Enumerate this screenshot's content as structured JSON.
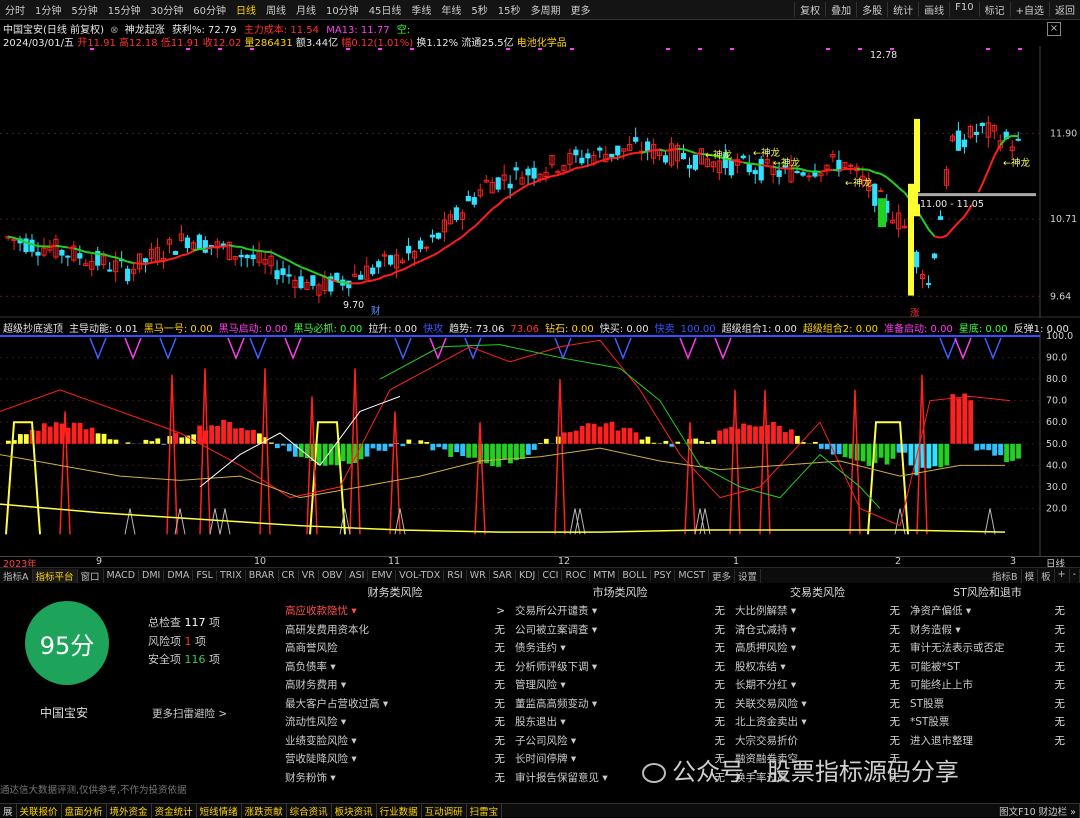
{
  "toolbar": {
    "left": [
      "分时",
      "1分钟",
      "5分钟",
      "15分钟",
      "30分钟",
      "60分钟",
      "日线",
      "周线",
      "月线",
      "10分钟",
      "45日线",
      "季线",
      "年线",
      "5秒",
      "15秒",
      "多周期",
      "更多"
    ],
    "active": "日线",
    "right": [
      "复权",
      "叠加",
      "多股",
      "统计",
      "画线",
      "F10",
      "标记",
      "+自选",
      "返回"
    ]
  },
  "header": {
    "stock": "中国宝安(日线 前复权)",
    "ind_name": "神龙起涨",
    "profit": "获利%: 72.79",
    "main_cost": "主力成本: 11.54",
    "ma13": "MA13: 11.77",
    "empty": "空:"
  },
  "bar": {
    "date": "2024/03/01/五",
    "open": "开11.91",
    "high": "高12.18",
    "low": "低11.91",
    "close": "收12.02",
    "vol": "量286431",
    "amt": "额3.44亿",
    "chg": "幅0.12(1.01%)",
    "turn": "换1.12%",
    "float": "流通25.5亿",
    "sector": "电池化学品"
  },
  "price_axis": [
    "11.90",
    "10.71",
    "9.64"
  ],
  "price_marks": {
    "high": "12.78",
    "low": "9.70",
    "range": "11.00 - 11.05",
    "tag": "涨",
    "cai": "财",
    "signal": "←神龙"
  },
  "indicator": {
    "title": "超级抄底逃顶",
    "items": [
      {
        "k": "主导动能: 0.01",
        "c": "#e6e6e6"
      },
      {
        "k": "黑马一号: 0.00",
        "c": "#ffd400"
      },
      {
        "k": "黑马启动: 0.00",
        "c": "#ff3df0"
      },
      {
        "k": "黑马必抓: 0.00",
        "c": "#3cff3c"
      },
      {
        "k": "拉升: 0.00",
        "c": "#e6e6e6"
      },
      {
        "k": "快攻",
        "c": "#3a55ff"
      },
      {
        "k": "趋势: 73.06",
        "c": "#e6e6e6"
      },
      {
        "k": "73.06",
        "c": "#ff3030"
      },
      {
        "k": "钻石: 0.00",
        "c": "#ffd400"
      },
      {
        "k": "快买: 0.00",
        "c": "#e6e6e6"
      },
      {
        "k": "快卖",
        "c": "#3a55ff"
      },
      {
        "k": "100.00",
        "c": "#3a55ff"
      },
      {
        "k": "超级组合1: 0.00",
        "c": "#e6e6e6"
      },
      {
        "k": "超级组合2: 0.00",
        "c": "#ffd400"
      },
      {
        "k": "准备启动: 0.00",
        "c": "#ff3df0"
      },
      {
        "k": "星底: 0.00",
        "c": "#3cff3c"
      },
      {
        "k": "反弹1: 0.00",
        "c": "#e6e6e6"
      }
    ]
  },
  "ind_axis": [
    "100.0",
    "90.0",
    "80.0",
    "70.0",
    "60.0",
    "50.0",
    "40.0",
    "30.0",
    "20.0"
  ],
  "x_axis": [
    "2023年",
    "9",
    "10",
    "11",
    "12",
    "1",
    "2",
    "3"
  ],
  "x_right": "日线",
  "tabs": [
    "指标A",
    "指标平台",
    "窗口",
    "MACD",
    "DMI",
    "DMA",
    "FSL",
    "TRIX",
    "BRAR",
    "CR",
    "VR",
    "OBV",
    "ASI",
    "EMV",
    "VOL-TDX",
    "RSI",
    "WR",
    "SAR",
    "KDJ",
    "CCI",
    "ROC",
    "MTM",
    "BOLL",
    "PSY",
    "MCST",
    "更多",
    "设置"
  ],
  "tabs_right": [
    "指标B",
    "模",
    "板",
    "+",
    "-"
  ],
  "scan": {
    "score": "95分",
    "stock": "中国宝安",
    "total_k": "总检查",
    "total_v": "117",
    "total_u": "项",
    "risk_k": "风险项",
    "risk_v": "1",
    "risk_u": "项",
    "safe_k": "安全项",
    "safe_v": "116",
    "safe_u": "项",
    "more": "更多扫雷避险 >",
    "note": "通达信大数据评测,仅供参考,不作为投资依据"
  },
  "columns": [
    {
      "title": "财务类风险",
      "rows": [
        [
          "高应收款隐忧 ▾",
          ">"
        ],
        [
          "高研发费用资本化",
          "无"
        ],
        [
          "高商誉风险",
          "无"
        ],
        [
          "高负债率 ▾",
          "无"
        ],
        [
          "高财务费用 ▾",
          "无"
        ],
        [
          "最大客户占营收过高 ▾",
          "无"
        ],
        [
          "流动性风险 ▾",
          "无"
        ],
        [
          "业绩变脸风险 ▾",
          "无"
        ],
        [
          "营收陡降风险 ▾",
          "无"
        ],
        [
          "财务粉饰 ▾",
          "无"
        ]
      ]
    },
    {
      "title": "市场类风险",
      "rows": [
        [
          "交易所公开谴责 ▾",
          "无"
        ],
        [
          "公司被立案调查 ▾",
          "无"
        ],
        [
          "债务违约 ▾",
          "无"
        ],
        [
          "分析师评级下调 ▾",
          "无"
        ],
        [
          "管理风险 ▾",
          "无"
        ],
        [
          "董监高高频变动 ▾",
          "无"
        ],
        [
          "股东退出 ▾",
          "无"
        ],
        [
          "子公司风险 ▾",
          "无"
        ],
        [
          "长时间停牌 ▾",
          "无"
        ],
        [
          "审计报告保留意见 ▾",
          "无"
        ]
      ]
    },
    {
      "title": "交易类风险",
      "rows": [
        [
          "大比例解禁 ▾",
          "无"
        ],
        [
          "清仓式减持 ▾",
          "无"
        ],
        [
          "高质押风险 ▾",
          "无"
        ],
        [
          "股权冻结 ▾",
          "无"
        ],
        [
          "长期不分红 ▾",
          "无"
        ],
        [
          "关联交易风险 ▾",
          "无"
        ],
        [
          "北上资金卖出 ▾",
          "无"
        ],
        [
          "大宗交易折价",
          "无"
        ],
        [
          "融资融券卖空",
          "无"
        ],
        [
          "换手率过高",
          "无"
        ]
      ]
    },
    {
      "title": "ST风险和退市",
      "rows": [
        [
          "净资产偏低 ▾",
          "无"
        ],
        [
          "财务造假 ▾",
          "无"
        ],
        [
          "审计无法表示或否定",
          "无"
        ],
        [
          "可能被*ST",
          "无"
        ],
        [
          "可能终止上市",
          "无"
        ],
        [
          "ST股票",
          "无"
        ],
        [
          "*ST股票",
          "无"
        ],
        [
          "进入退市整理",
          "无"
        ]
      ]
    }
  ],
  "status": [
    "展",
    "关联报价",
    "盘面分析",
    "境外资金",
    "资金统计",
    "短线情绪",
    "涨跌贡献",
    "综合资讯",
    "板块资讯",
    "行业数据",
    "互动调研",
    "扫雷宝"
  ],
  "status_right": "图文F10 财边栏 »",
  "watermark": "公众号 · 股票指标源码分享",
  "colors": {
    "up": "#ff2020",
    "down": "#30e0ff",
    "ma_red": "#ff1e1e",
    "ma_green": "#22d022",
    "yellow": "#ffff40",
    "score_green": "#1ea35a"
  }
}
